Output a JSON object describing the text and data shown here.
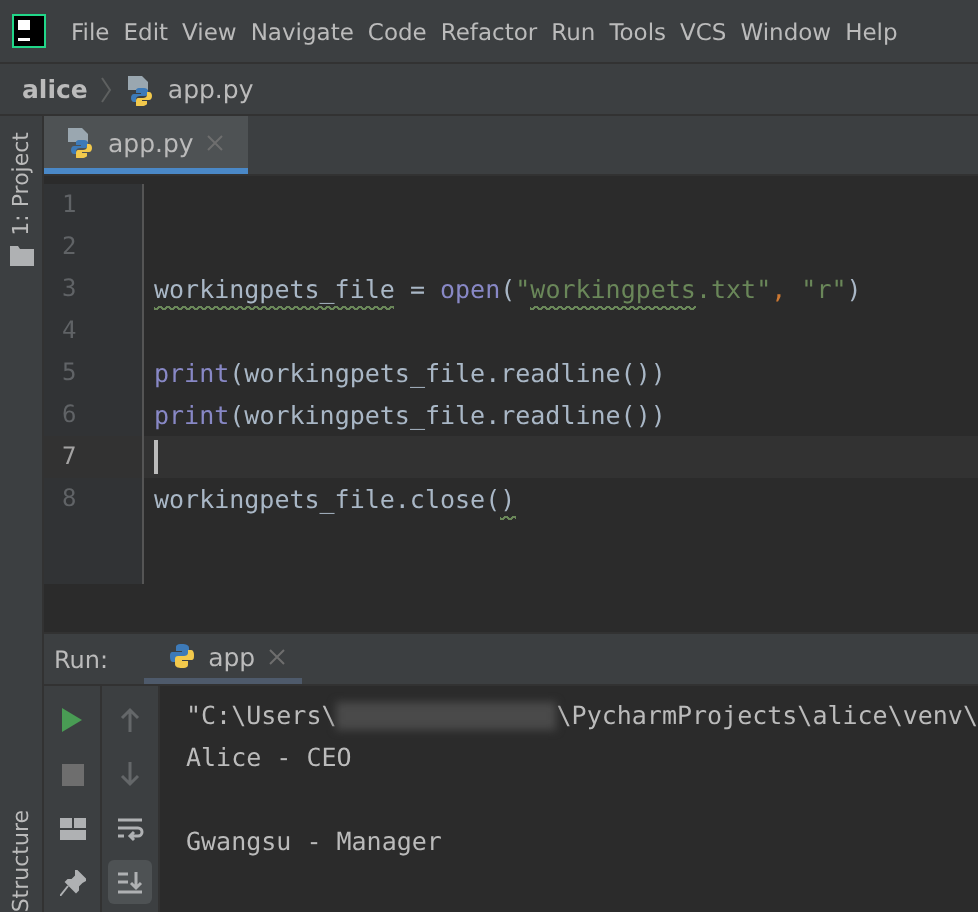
{
  "menu_bar": {
    "items": [
      {
        "label": "File"
      },
      {
        "label": "Edit"
      },
      {
        "label": "View"
      },
      {
        "label": "Navigate"
      },
      {
        "label": "Code"
      },
      {
        "label": "Refactor"
      },
      {
        "label": "Run"
      },
      {
        "label": "Tools"
      },
      {
        "label": "VCS"
      },
      {
        "label": "Window"
      },
      {
        "label": "Help"
      }
    ]
  },
  "breadcrumb": {
    "project": "alice",
    "file": "app.py"
  },
  "side_strip": {
    "top_label": "1: Project",
    "bottom_label": "Structure"
  },
  "editor_tabs": [
    {
      "label": "app.py",
      "selected": true
    }
  ],
  "code_lines": [
    {
      "number": "1",
      "current": false
    },
    {
      "number": "2",
      "current": false
    },
    {
      "number": "3",
      "current": false,
      "tokens": [
        {
          "text": "workingpets_file",
          "kind": "plain",
          "warning": true
        },
        {
          "text": " = ",
          "kind": "plain",
          "warning": false
        },
        {
          "text": "open",
          "kind": "builtin",
          "warning": false
        },
        {
          "text": "(",
          "kind": "plain",
          "warning": false
        },
        {
          "text": "\"",
          "kind": "string",
          "warning": false
        },
        {
          "text": "workingpets",
          "kind": "string",
          "warning": true
        },
        {
          "text": ".txt\"",
          "kind": "string",
          "warning": false
        },
        {
          "text": ", ",
          "kind": "punct",
          "warning": false
        },
        {
          "text": "\"r\"",
          "kind": "string",
          "warning": false
        },
        {
          "text": ")",
          "kind": "plain",
          "warning": false
        }
      ]
    },
    {
      "number": "4",
      "current": false
    },
    {
      "number": "5",
      "current": false,
      "tokens": [
        {
          "text": "print",
          "kind": "builtin",
          "warning": false
        },
        {
          "text": "(workingpets_file.readline())",
          "kind": "plain",
          "warning": false
        }
      ]
    },
    {
      "number": "6",
      "current": false,
      "tokens": [
        {
          "text": "print",
          "kind": "builtin",
          "warning": false
        },
        {
          "text": "(workingpets_file.readline())",
          "kind": "plain",
          "warning": false
        }
      ]
    },
    {
      "number": "7",
      "current": true
    },
    {
      "number": "8",
      "current": false,
      "tokens": [
        {
          "text": "workingpets_file.close(",
          "kind": "plain",
          "warning": false
        },
        {
          "text": ")",
          "kind": "plain",
          "warning": true
        }
      ]
    }
  ],
  "run_panel": {
    "label": "Run:",
    "tabs": [
      {
        "label": "app",
        "selected": true
      }
    ],
    "toolbar": [
      {
        "kind": "up",
        "disabled": true,
        "selected": false
      },
      {
        "kind": "down",
        "disabled": true,
        "selected": false
      },
      {
        "kind": "wrap",
        "disabled": false,
        "selected": false
      },
      {
        "kind": "scroll-end",
        "disabled": false,
        "selected": true
      }
    ],
    "console": [
      {
        "kind": "path",
        "before": "\"C:\\Users\\",
        "after": "\\PycharmProjects\\alice\\venv\\"
      },
      {
        "kind": "text",
        "text": "Alice - CEO"
      },
      {
        "kind": "blank"
      },
      {
        "kind": "text",
        "text": "Gwangsu - Manager"
      }
    ]
  }
}
